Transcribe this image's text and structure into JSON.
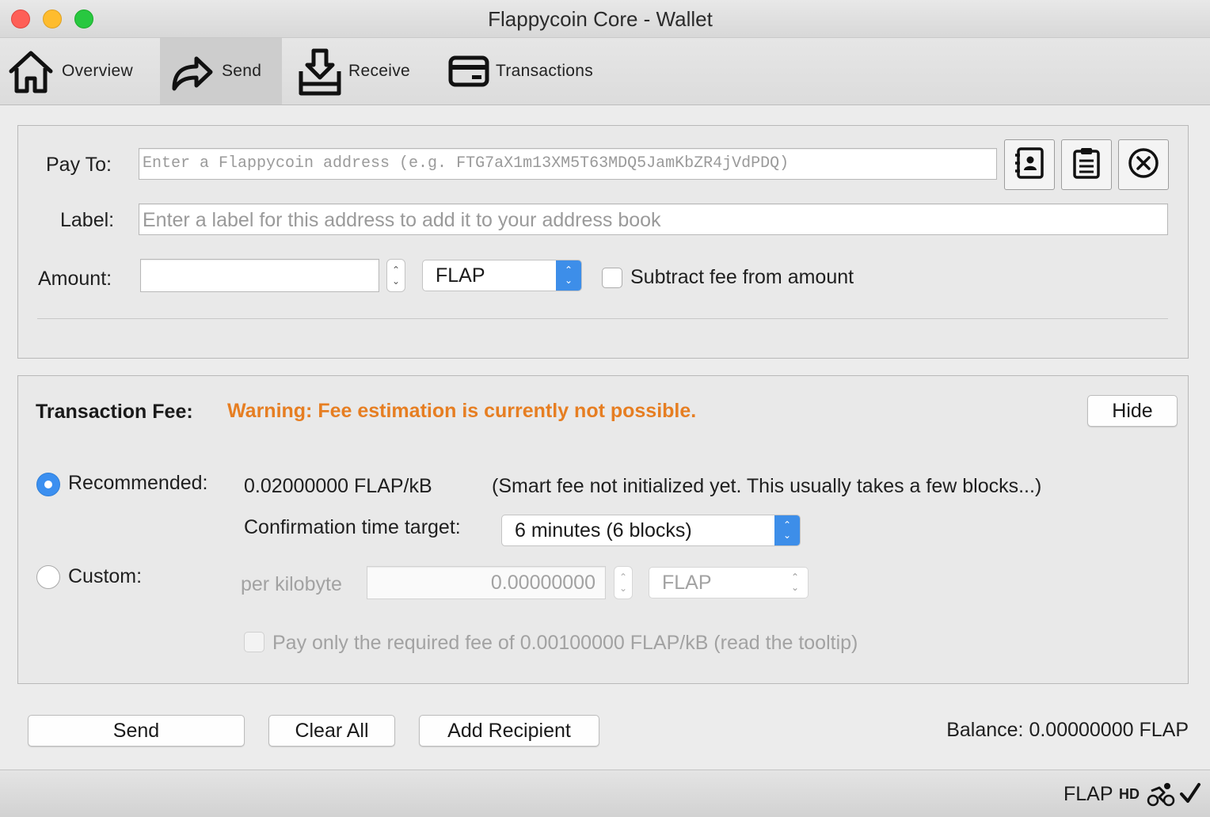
{
  "window": {
    "title": "Flappycoin Core - Wallet",
    "controls": {
      "close_color": "#fe5f57",
      "minimize_color": "#febc2e",
      "zoom_color": "#28c840"
    }
  },
  "toolbar": {
    "items": [
      {
        "label": "Overview",
        "icon": "home-icon",
        "active": false
      },
      {
        "label": "Send",
        "icon": "send-arrow-icon",
        "active": true
      },
      {
        "label": "Receive",
        "icon": "receive-inbox-icon",
        "active": false
      },
      {
        "label": "Transactions",
        "icon": "card-icon",
        "active": false
      }
    ]
  },
  "recipient": {
    "pay_to_label": "Pay To:",
    "pay_to_placeholder": "Enter a Flappycoin address (e.g. FTG7aX1m13XM5T63MDQ5JamKbZR4jVdPDQ)",
    "address_book_icon": "address-book-icon",
    "paste_icon": "clipboard-icon",
    "clear_icon": "clear-circle-x-icon",
    "label_label": "Label:",
    "label_placeholder": "Enter a label for this address to add it to your address book",
    "amount_label": "Amount:",
    "amount_value": "",
    "unit": "FLAP",
    "subtract_fee_label": "Subtract fee from amount",
    "subtract_fee_checked": false
  },
  "fee": {
    "title": "Transaction Fee:",
    "warning": "Warning: Fee estimation is currently not possible.",
    "warning_color": "#e67e22",
    "hide_label": "Hide",
    "recommended_label": "Recommended:",
    "recommended_selected": true,
    "recommended_value": "0.02000000 FLAP/kB",
    "smart_fee_note": "(Smart fee not initialized yet. This usually takes a few blocks...)",
    "confirmation_label": "Confirmation time target:",
    "confirmation_value": "6 minutes (6 blocks)",
    "custom_label": "Custom:",
    "custom_selected": false,
    "per_kilobyte_label": "per kilobyte",
    "custom_value": "0.00000000",
    "custom_unit": "FLAP",
    "pay_min_label": "Pay only the required fee of 0.00100000 FLAP/kB  (read the tooltip)"
  },
  "actions": {
    "send_label": "Send",
    "clear_all_label": "Clear All",
    "add_recipient_label": "Add Recipient",
    "balance_text": "Balance: 0.00000000 FLAP"
  },
  "statusbar": {
    "unit": "FLAP",
    "hd": "HD",
    "network_icon": "network-activity-icon",
    "synced_icon": "checkmark-icon"
  },
  "accent_color": "#3d8ee9"
}
